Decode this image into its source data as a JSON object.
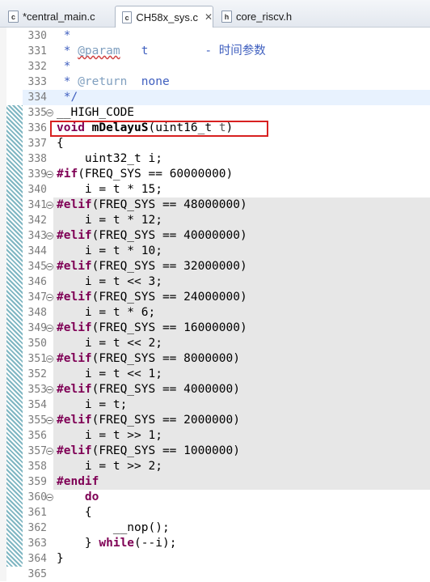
{
  "tabs": [
    {
      "label": "*central_main.c",
      "icon": "c-file-icon",
      "active": false
    },
    {
      "label": "CH58x_sys.c",
      "icon": "c-file-icon",
      "active": true,
      "close": "✕"
    },
    {
      "label": "core_riscv.h",
      "icon": "h-file-icon",
      "active": false
    }
  ],
  "code": {
    "l330": {
      "n": "330",
      "t": " *"
    },
    "l331": {
      "n": "331",
      "a": " * ",
      "b": "@param",
      "c": "   t        - 时间参数"
    },
    "l332": {
      "n": "332",
      "t": " *"
    },
    "l333": {
      "n": "333",
      "a": " * ",
      "b": "@return",
      "c": "  none"
    },
    "l334": {
      "n": "334",
      "t": " */"
    },
    "l335": {
      "n": "335",
      "t": "__HIGH_CODE"
    },
    "l336": {
      "n": "336",
      "kw": "void",
      "fn": "mDelayuS",
      "open": "(uint16_t ",
      "par": "t",
      "close": ")"
    },
    "l337": {
      "n": "337",
      "t": "{"
    },
    "l338": {
      "n": "338",
      "t": "    uint32_t i;"
    },
    "l339": {
      "n": "339",
      "pp": "#if",
      "t": "(FREQ_SYS == 60000000)"
    },
    "l340": {
      "n": "340",
      "t": "    i = t * 15;"
    },
    "l341": {
      "n": "341",
      "pp": "#elif",
      "t": "(FREQ_SYS == 48000000)"
    },
    "l342": {
      "n": "342",
      "t": "    i = t * 12;"
    },
    "l343": {
      "n": "343",
      "pp": "#elif",
      "t": "(FREQ_SYS == 40000000)"
    },
    "l344": {
      "n": "344",
      "t": "    i = t * 10;"
    },
    "l345": {
      "n": "345",
      "pp": "#elif",
      "t": "(FREQ_SYS == 32000000)"
    },
    "l346": {
      "n": "346",
      "t": "    i = t << 3;"
    },
    "l347": {
      "n": "347",
      "pp": "#elif",
      "t": "(FREQ_SYS == 24000000)"
    },
    "l348": {
      "n": "348",
      "t": "    i = t * 6;"
    },
    "l349": {
      "n": "349",
      "pp": "#elif",
      "t": "(FREQ_SYS == 16000000)"
    },
    "l350": {
      "n": "350",
      "t": "    i = t << 2;"
    },
    "l351": {
      "n": "351",
      "pp": "#elif",
      "t": "(FREQ_SYS == 8000000)"
    },
    "l352": {
      "n": "352",
      "t": "    i = t << 1;"
    },
    "l353": {
      "n": "353",
      "pp": "#elif",
      "t": "(FREQ_SYS == 4000000)"
    },
    "l354": {
      "n": "354",
      "t": "    i = t;"
    },
    "l355": {
      "n": "355",
      "pp": "#elif",
      "t": "(FREQ_SYS == 2000000)"
    },
    "l356": {
      "n": "356",
      "t": "    i = t >> 1;"
    },
    "l357": {
      "n": "357",
      "pp": "#elif",
      "t": "(FREQ_SYS == 1000000)"
    },
    "l358": {
      "n": "358",
      "t": "    i = t >> 2;"
    },
    "l359": {
      "n": "359",
      "pp": "#endif"
    },
    "l360": {
      "n": "360",
      "ind": "    ",
      "kw": "do"
    },
    "l361": {
      "n": "361",
      "t": "    {"
    },
    "l362": {
      "n": "362",
      "t": "        __nop();"
    },
    "l363": {
      "n": "363",
      "a": "    } ",
      "kw": "while",
      "c": "(--i);"
    },
    "l364": {
      "n": "364",
      "t": "}"
    },
    "l365": {
      "n": "365",
      "t": ""
    }
  }
}
